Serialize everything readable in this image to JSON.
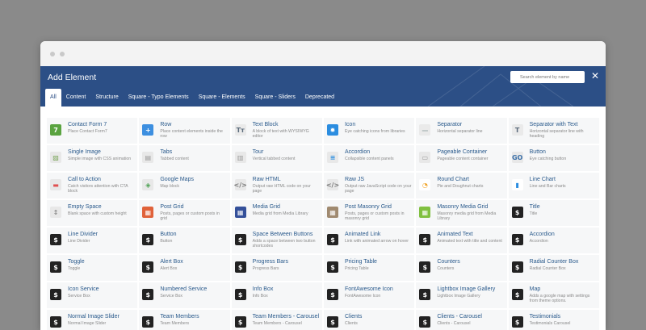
{
  "header": {
    "title": "Add Element",
    "search_placeholder": "Search element by name",
    "close_glyph": "✕"
  },
  "tabs": [
    {
      "label": "All",
      "active": true
    },
    {
      "label": "Content"
    },
    {
      "label": "Structure"
    },
    {
      "label": "Square - Typo Elements"
    },
    {
      "label": "Square - Elements"
    },
    {
      "label": "Square - Sliders"
    },
    {
      "label": "Deprecated"
    }
  ],
  "elements": [
    {
      "title": "Contact Form 7",
      "desc": "Place Contact Form7",
      "icon": "contact-form-icon",
      "color": "#5aa340",
      "glyph": "7"
    },
    {
      "title": "Row",
      "desc": "Place content elements inside the row",
      "icon": "plus-icon",
      "color": "#3d8fe0",
      "glyph": "+"
    },
    {
      "title": "Text Block",
      "desc": "A block of text with WYSIWYG editor",
      "icon": "text-block-icon",
      "color": "#eaeaea",
      "glyph": "Tт",
      "fg": "#5b6b7c"
    },
    {
      "title": "Icon",
      "desc": "Eye catching icons from libraries",
      "icon": "star-icon",
      "color": "#2b8de0",
      "glyph": "✹"
    },
    {
      "title": "Separator",
      "desc": "Horizontal separator line",
      "icon": "separator-icon",
      "color": "#eaeaea",
      "glyph": "—",
      "fg": "#9aa"
    },
    {
      "title": "Separator with Text",
      "desc": "Horizontal separator line with heading",
      "icon": "separator-text-icon",
      "color": "#eaeaea",
      "glyph": "T",
      "fg": "#5b6b7c"
    },
    {
      "title": "Single Image",
      "desc": "Simple image with CSS animation",
      "icon": "image-icon",
      "color": "#e8e8e8",
      "glyph": "▨",
      "fg": "#7aa55a"
    },
    {
      "title": "Tabs",
      "desc": "Tabbed content",
      "icon": "tabs-icon",
      "color": "#e8e8e8",
      "glyph": "▤",
      "fg": "#999"
    },
    {
      "title": "Tour",
      "desc": "Vertical tabbed content",
      "icon": "tour-icon",
      "color": "#e8e8e8",
      "glyph": "▥",
      "fg": "#999"
    },
    {
      "title": "Accordion",
      "desc": "Collapsible content panels",
      "icon": "accordion-icon",
      "color": "#e8e8e8",
      "glyph": "≡",
      "fg": "#2b8de0"
    },
    {
      "title": "Pageable Container",
      "desc": "Pageable content container",
      "icon": "pageable-icon",
      "color": "#e8e8e8",
      "glyph": "▭",
      "fg": "#999"
    },
    {
      "title": "Button",
      "desc": "Eye catching button",
      "icon": "button-icon",
      "color": "#e8e8e8",
      "glyph": "GO",
      "fg": "#3a6fa8"
    },
    {
      "title": "Call to Action",
      "desc": "Catch visitors attention with CTA block",
      "icon": "cta-icon",
      "color": "#e8e8e8",
      "glyph": "▬",
      "fg": "#e05050"
    },
    {
      "title": "Google Maps",
      "desc": "Map block",
      "icon": "map-icon",
      "color": "#e8e8e8",
      "glyph": "◈",
      "fg": "#4aa050"
    },
    {
      "title": "Raw HTML",
      "desc": "Output raw HTML code on your page",
      "icon": "raw-html-icon",
      "color": "#e8e8e8",
      "glyph": "</>",
      "fg": "#777"
    },
    {
      "title": "Raw JS",
      "desc": "Output raw JavaScript code on your page",
      "icon": "raw-js-icon",
      "color": "#e8e8e8",
      "glyph": "</>",
      "fg": "#777"
    },
    {
      "title": "Round Chart",
      "desc": "Pie and Doughnut charts",
      "icon": "round-chart-icon",
      "color": "#ffffff",
      "glyph": "◔",
      "fg": "#f0a020"
    },
    {
      "title": "Line Chart",
      "desc": "Line and Bar charts",
      "icon": "line-chart-icon",
      "color": "#ffffff",
      "glyph": "▮",
      "fg": "#2b8de0"
    },
    {
      "title": "Empty Space",
      "desc": "Blank space with custom height",
      "icon": "empty-space-icon",
      "color": "#e8e8e8",
      "glyph": "↕",
      "fg": "#888"
    },
    {
      "title": "Post Grid",
      "desc": "Posts, pages or custom posts in grid",
      "icon": "post-grid-icon",
      "color": "#e0623a",
      "glyph": "▦"
    },
    {
      "title": "Media Grid",
      "desc": "Media grid from Media Library",
      "icon": "media-grid-icon",
      "color": "#34509a",
      "glyph": "▦"
    },
    {
      "title": "Post Masonry Grid",
      "desc": "Posts, pages or custom posts in masonry grid",
      "icon": "post-masonry-icon",
      "color": "#a08a70",
      "glyph": "▦"
    },
    {
      "title": "Masonry Media Grid",
      "desc": "Masonry media grid from Media Library",
      "icon": "masonry-media-icon",
      "color": "#80c040",
      "glyph": "▦"
    },
    {
      "title": "Title",
      "desc": "Title",
      "icon": "dollar-icon",
      "color": "#222222",
      "glyph": "$"
    },
    {
      "title": "Line Divider",
      "desc": "Line Divider",
      "icon": "dollar-icon",
      "color": "#222222",
      "glyph": "$"
    },
    {
      "title": "Button",
      "desc": "Button",
      "icon": "dollar-icon",
      "color": "#222222",
      "glyph": "$"
    },
    {
      "title": "Space Between Buttons",
      "desc": "Adds a space between two button shortcodes",
      "icon": "dollar-icon",
      "color": "#222222",
      "glyph": "$"
    },
    {
      "title": "Animated Link",
      "desc": "Link with animated arrow on hover",
      "icon": "dollar-icon",
      "color": "#222222",
      "glyph": "$"
    },
    {
      "title": "Animated Text",
      "desc": "Animated text with title and content",
      "icon": "dollar-icon",
      "color": "#222222",
      "glyph": "$"
    },
    {
      "title": "Accordion",
      "desc": "Accordion",
      "icon": "dollar-icon",
      "color": "#222222",
      "glyph": "$"
    },
    {
      "title": "Toggle",
      "desc": "Toggle",
      "icon": "dollar-icon",
      "color": "#222222",
      "glyph": "$"
    },
    {
      "title": "Alert Box",
      "desc": "Alert Box",
      "icon": "dollar-icon",
      "color": "#222222",
      "glyph": "$"
    },
    {
      "title": "Progress Bars",
      "desc": "Progress Bars",
      "icon": "dollar-icon",
      "color": "#222222",
      "glyph": "$"
    },
    {
      "title": "Pricing Table",
      "desc": "Pricing Table",
      "icon": "dollar-icon",
      "color": "#222222",
      "glyph": "$"
    },
    {
      "title": "Counters",
      "desc": "Counters",
      "icon": "dollar-icon",
      "color": "#222222",
      "glyph": "$"
    },
    {
      "title": "Radial Counter Box",
      "desc": "Radial Counter Box",
      "icon": "dollar-icon",
      "color": "#222222",
      "glyph": "$"
    },
    {
      "title": "Icon Service",
      "desc": "Service Box",
      "icon": "dollar-icon",
      "color": "#222222",
      "glyph": "$"
    },
    {
      "title": "Numbered Service",
      "desc": "Service Box",
      "icon": "dollar-icon",
      "color": "#222222",
      "glyph": "$"
    },
    {
      "title": "Info Box",
      "desc": "Info Box",
      "icon": "dollar-icon",
      "color": "#222222",
      "glyph": "$"
    },
    {
      "title": "FontAwesome Icon",
      "desc": "FontAwesome Icon",
      "icon": "dollar-icon",
      "color": "#222222",
      "glyph": "$"
    },
    {
      "title": "Lightbox Image Gallery",
      "desc": "Lightbox Image Gallery",
      "icon": "dollar-icon",
      "color": "#222222",
      "glyph": "$"
    },
    {
      "title": "Map",
      "desc": "Adds a google map with settings from theme options.",
      "icon": "dollar-icon",
      "color": "#222222",
      "glyph": "$"
    },
    {
      "title": "Normal Image Slider",
      "desc": "Normal Image Slider",
      "icon": "dollar-icon",
      "color": "#222222",
      "glyph": "$"
    },
    {
      "title": "Team Members",
      "desc": "Team Members",
      "icon": "dollar-icon",
      "color": "#222222",
      "glyph": "$"
    },
    {
      "title": "Team Members - Carousel",
      "desc": "Team Members - Carousel",
      "icon": "dollar-icon",
      "color": "#222222",
      "glyph": "$"
    },
    {
      "title": "Clients",
      "desc": "Clients",
      "icon": "dollar-icon",
      "color": "#222222",
      "glyph": "$"
    },
    {
      "title": "Clients - Carousel",
      "desc": "Clients - Carousel",
      "icon": "dollar-icon",
      "color": "#222222",
      "glyph": "$"
    },
    {
      "title": "Testimonials",
      "desc": "Testimonials Carousel",
      "icon": "dollar-icon",
      "color": "#222222",
      "glyph": "$"
    }
  ]
}
